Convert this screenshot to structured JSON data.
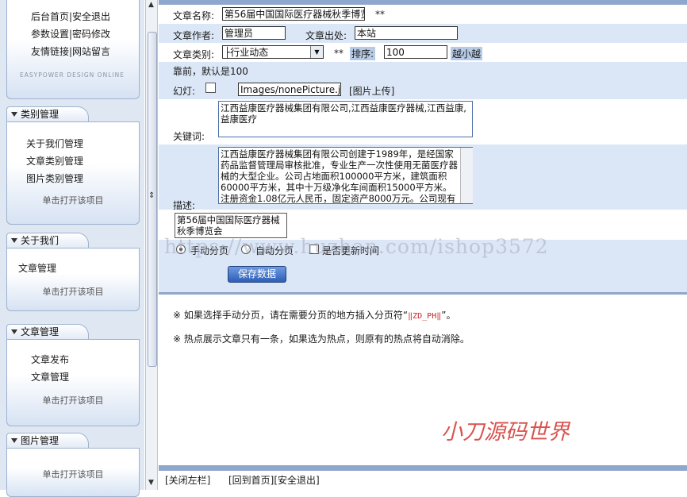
{
  "sidebar": {
    "top_panel": {
      "items": [
        "后台首页|安全退出",
        "参数设置|密码修改",
        "友情链接|网站留言"
      ],
      "brand": "EASYPOWER DESIGN ONLINE"
    },
    "panels": [
      {
        "title": "类别管理",
        "items": [
          "关于我们管理",
          "文章类别管理",
          "图片类别管理"
        ],
        "open_label": "单击打开该项目"
      },
      {
        "title": "关于我们",
        "items": [
          "文章管理"
        ],
        "open_label": "单击打开该项目"
      },
      {
        "title": "文章管理",
        "items": [
          "文章发布",
          "文章管理"
        ],
        "open_label": "单击打开该项目"
      },
      {
        "title": "图片管理",
        "items": [],
        "open_label": "单击打开该项目"
      }
    ]
  },
  "form": {
    "title_label": "文章名称:",
    "title_value": "第56届中国国际医疗器械秋季博览",
    "required_mark": "**",
    "author_label": "文章作者:",
    "author_value": "管理员",
    "source_label": "文章出处:",
    "source_value": "本站",
    "category_label": "文章类别:",
    "category_value": "├行业动态",
    "sort_label": "排序:",
    "sort_value": "100",
    "sort_hint": "越小越",
    "sort_hint2": "靠前，默认是100",
    "slide_label": "幻灯:",
    "image_path": "Images/nonePicture.jpg",
    "upload_link": "[图片上传]",
    "keywords_label": "关键词:",
    "keywords_value": "江西益康医疗器械集团有限公司,江西益康医疗器械,江西益康,益康医疗",
    "desc_label": "描述:",
    "desc_value": "江西益康医疗器械集团有限公司创建于1989年，是经国家药品监督管理局审核批准，专业生产一次性使用无菌医疗器械的大型企业。公司占地面积100000平方米，建筑面积60000平方米，其中十万级净化车间面积15000平方米。注册资金1.08亿元人民币，固定资产8000万元。公司现有员",
    "content_preview": "第56届中国国际医疗器械秋季博览会",
    "paging_manual": "手动分页",
    "paging_auto": "自动分页",
    "update_time": "是否更新时间",
    "save_button": "保存数据"
  },
  "notes": {
    "note1_pre": "※ 如果选择手动分页，请在需要分页的地方插入分页符“",
    "note1_code": "‖ZD_PH‖",
    "note1_post": "”。",
    "note2": "※ 热点展示文章只有一条，如果选为热点，则原有的热点将自动消除。"
  },
  "watermarks": {
    "url": "https://www.huzhan.com/ishop3572",
    "brand": "小刀源码世界"
  },
  "footer": {
    "close_left": "[关闭左栏]",
    "home_logout": "[回到首页][安全退出]"
  },
  "colors": {
    "row_alt": "#dbe7f6",
    "accent": "#2d5fb8",
    "watermark_red": "#d9534f"
  }
}
